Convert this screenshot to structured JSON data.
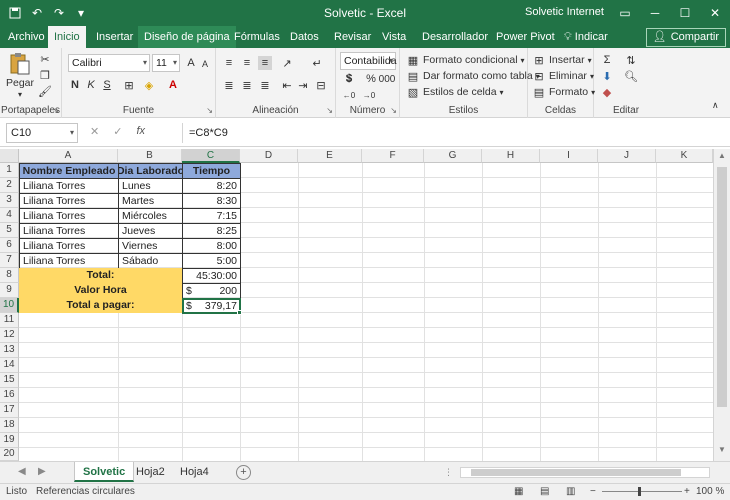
{
  "titlebar": {
    "title": "Solvetic  -  Excel",
    "user": "Solvetic Internet",
    "save_icon": "save-icon",
    "undo_icon": "undo-icon",
    "redo_icon": "redo-icon"
  },
  "tabs": [
    "Archivo",
    "Inicio",
    "Insertar",
    "Diseño de página",
    "Fórmulas",
    "Datos",
    "Revisar",
    "Vista",
    "Desarrollador",
    "Power Pivot"
  ],
  "tell_me": "Indicar",
  "share": "Compartir",
  "ribbon": {
    "clipboard": {
      "paste": "Pegar",
      "label": "Portapapeles"
    },
    "font": {
      "name": "Calibri",
      "size": "11",
      "label": "Fuente"
    },
    "alignment": {
      "label": "Alineación"
    },
    "number": {
      "format": "Contabilida",
      "label": "Número"
    },
    "styles": {
      "conditional": "Formato condicional",
      "as_table": "Dar formato como tabla",
      "cell_styles": "Estilos de celda",
      "label": "Estilos"
    },
    "cells": {
      "insert": "Insertar",
      "delete": "Eliminar",
      "format": "Formato",
      "label": "Celdas"
    },
    "editing": {
      "label": "Editar"
    }
  },
  "formula_bar": {
    "name_box": "C10",
    "formula": "=C8*C9"
  },
  "columns": [
    "A",
    "B",
    "C",
    "D",
    "E",
    "F",
    "G",
    "H",
    "I",
    "J",
    "K"
  ],
  "table": {
    "headers": [
      "Nombre Empleado",
      "Dia Laborado",
      "Tiempo"
    ],
    "rows": [
      [
        "Liliana Torres",
        "Lunes",
        "8:20"
      ],
      [
        "Liliana Torres",
        "Martes",
        "8:30"
      ],
      [
        "Liliana Torres",
        "Miércoles",
        "7:15"
      ],
      [
        "Liliana Torres",
        "Jueves",
        "8:25"
      ],
      [
        "Liliana Torres",
        "Viernes",
        "8:00"
      ],
      [
        "Liliana Torres",
        "Sábado",
        "5:00"
      ]
    ],
    "total_label": "Total:",
    "total_value": "45:30:00",
    "rate_label": "Valor Hora",
    "rate_currency": "$",
    "rate_value": "200",
    "pay_label": "Total a pagar:",
    "pay_currency": "$",
    "pay_value": "379,17"
  },
  "sheets": [
    "Solvetic",
    "Hoja2",
    "Hoja4"
  ],
  "status": {
    "ready": "Listo",
    "circular": "Referencias circulares",
    "zoom": "100 %"
  }
}
